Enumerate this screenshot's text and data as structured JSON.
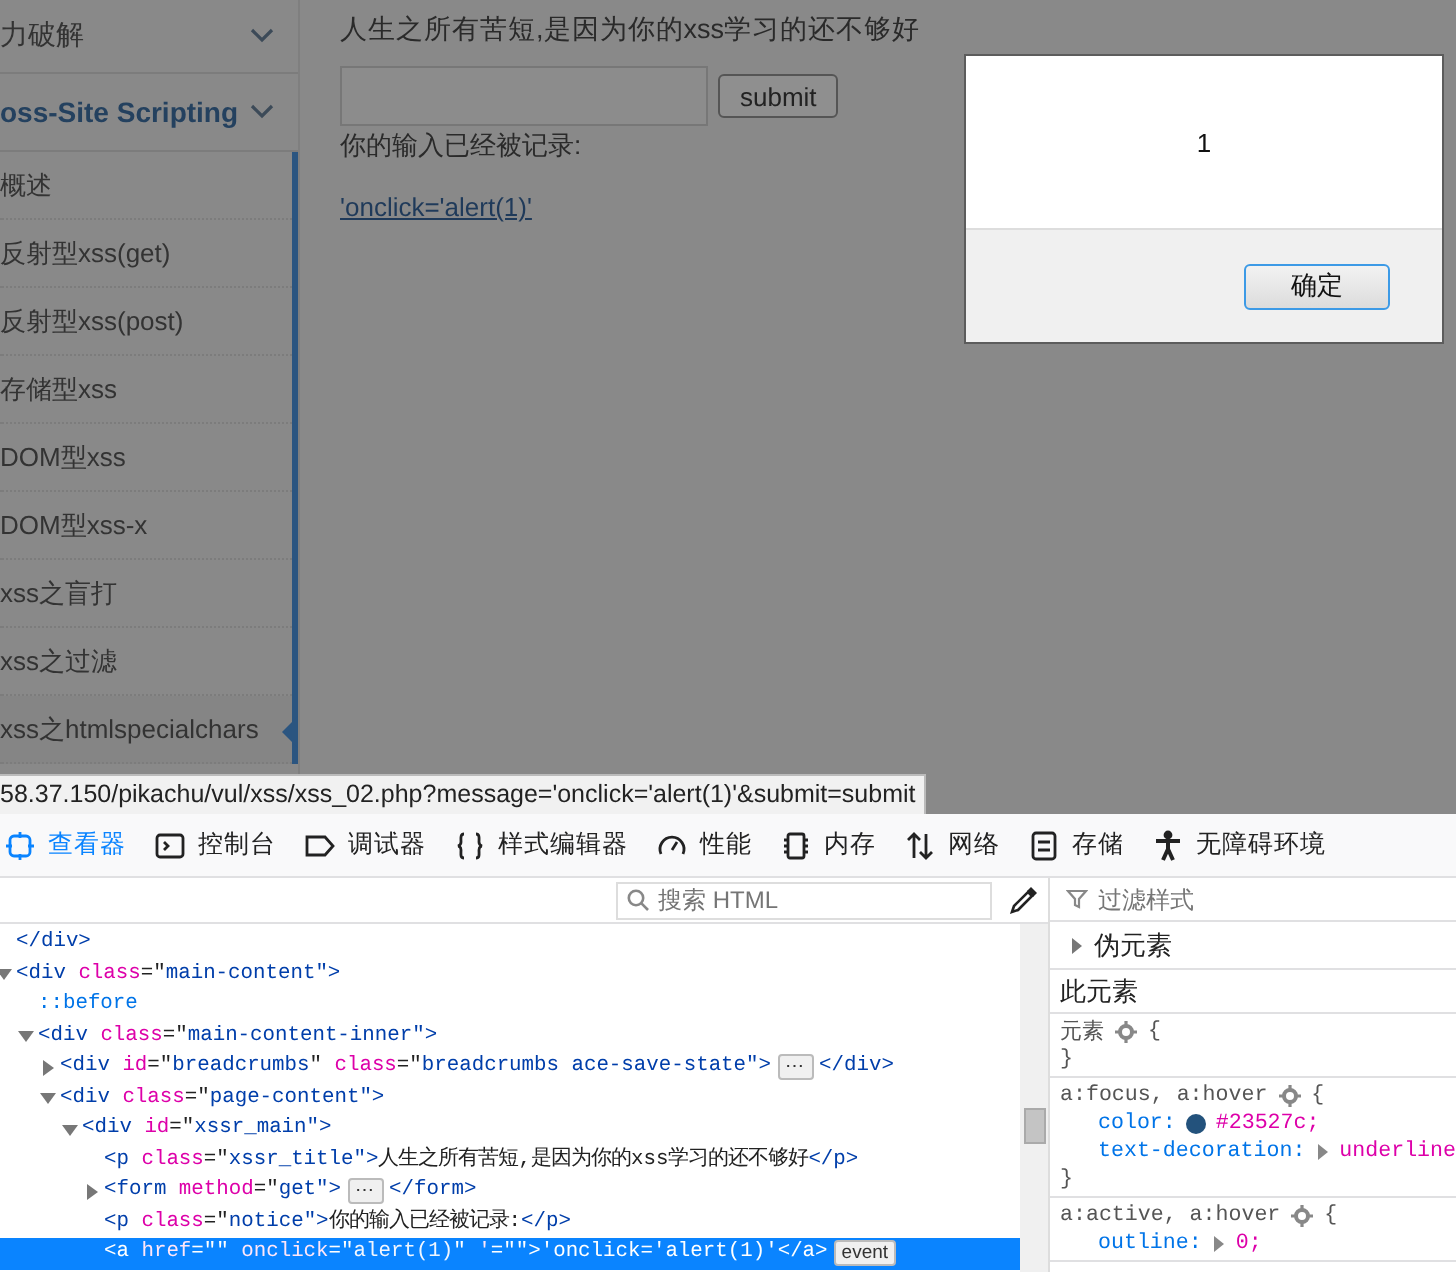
{
  "sidebar": {
    "sections": [
      {
        "label": "力破解",
        "selected": false
      },
      {
        "label": "oss-Site Scripting",
        "selected": true
      }
    ],
    "items": [
      {
        "label": "概述",
        "selected": false
      },
      {
        "label": "反射型xss(get)",
        "selected": false
      },
      {
        "label": "反射型xss(post)",
        "selected": false
      },
      {
        "label": "存储型xss",
        "selected": false
      },
      {
        "label": "DOM型xss",
        "selected": false
      },
      {
        "label": "DOM型xss-x",
        "selected": false
      },
      {
        "label": "xss之盲打",
        "selected": false
      },
      {
        "label": "xss之过滤",
        "selected": false
      },
      {
        "label": "xss之htmlspecialchars",
        "selected": true
      }
    ]
  },
  "main": {
    "title": "人生之所有苦短,是因为你的xss学习的还不够好",
    "submit": "submit",
    "notice": "你的输入已经被记录:",
    "link": "'onclick='alert(1)'"
  },
  "alert": {
    "message": "1",
    "button": "确定"
  },
  "status_url": "58.37.150/pikachu/vul/xss/xss_02.php?message='onclick='alert(1)'&submit=submit",
  "devtools": {
    "tabs": [
      {
        "label": "查看器",
        "selected": true
      },
      {
        "label": "控制台",
        "selected": false
      },
      {
        "label": "调试器",
        "selected": false
      },
      {
        "label": "样式编辑器",
        "selected": false
      },
      {
        "label": "性能",
        "selected": false
      },
      {
        "label": "内存",
        "selected": false
      },
      {
        "label": "网络",
        "selected": false
      },
      {
        "label": "存储",
        "selected": false
      },
      {
        "label": "无障碍环境",
        "selected": false
      }
    ],
    "search_placeholder": "搜索 HTML",
    "html_tree": [
      {
        "tokens": [
          {
            "text": "</div>",
            "kind": "tag"
          }
        ]
      },
      {
        "expanded": true,
        "tokens": [
          {
            "text": "<div ",
            "kind": "tag"
          },
          {
            "text": "class",
            "kind": "attr"
          },
          {
            "text": "=\"",
            "kind": "text"
          },
          {
            "text": "main-content",
            "kind": "value"
          },
          {
            "text": "\">",
            "kind": "tag"
          }
        ],
        "children": [
          {
            "tokens": [
              {
                "text": "::before",
                "kind": "pseudo"
              }
            ]
          },
          {
            "expanded": true,
            "tokens": [
              {
                "text": "<div ",
                "kind": "tag"
              },
              {
                "text": "class",
                "kind": "attr"
              },
              {
                "text": "=\"",
                "kind": "text"
              },
              {
                "text": "main-content-inner",
                "kind": "value"
              },
              {
                "text": "\">",
                "kind": "tag"
              }
            ],
            "children": [
              {
                "expanded": false,
                "tokens": [
                  {
                    "text": "<div ",
                    "kind": "tag"
                  },
                  {
                    "text": "id",
                    "kind": "attr"
                  },
                  {
                    "text": "=\"",
                    "kind": "text"
                  },
                  {
                    "text": "breadcrumbs",
                    "kind": "value"
                  },
                  {
                    "text": "\" ",
                    "kind": "text"
                  },
                  {
                    "text": "class",
                    "kind": "attr"
                  },
                  {
                    "text": "=\"",
                    "kind": "text"
                  },
                  {
                    "text": "breadcrumbs ace-save-state",
                    "kind": "value"
                  },
                  {
                    "text": "\">",
                    "kind": "tag"
                  }
                ],
                "badge": "⋯",
                "tail": [
                  {
                    "text": "</div>",
                    "kind": "tag"
                  }
                ]
              },
              {
                "expanded": true,
                "tokens": [
                  {
                    "text": "<div ",
                    "kind": "tag"
                  },
                  {
                    "text": "class",
                    "kind": "attr"
                  },
                  {
                    "text": "=\"",
                    "kind": "text"
                  },
                  {
                    "text": "page-content",
                    "kind": "value"
                  },
                  {
                    "text": "\">",
                    "kind": "tag"
                  }
                ],
                "children": [
                  {
                    "expanded": true,
                    "tokens": [
                      {
                        "text": "<div ",
                        "kind": "tag"
                      },
                      {
                        "text": "id",
                        "kind": "attr"
                      },
                      {
                        "text": "=\"",
                        "kind": "text"
                      },
                      {
                        "text": "xssr_main",
                        "kind": "value"
                      },
                      {
                        "text": "\">",
                        "kind": "tag"
                      }
                    ],
                    "children": [
                      {
                        "tokens": [
                          {
                            "text": "<p ",
                            "kind": "tag"
                          },
                          {
                            "text": "class",
                            "kind": "attr"
                          },
                          {
                            "text": "=\"",
                            "kind": "text"
                          },
                          {
                            "text": "xssr_title",
                            "kind": "value"
                          },
                          {
                            "text": "\">",
                            "kind": "tag"
                          },
                          {
                            "text": "人生之所有苦短,是因为你的xss学习的还不够好",
                            "kind": "text"
                          },
                          {
                            "text": "</p>",
                            "kind": "tag"
                          }
                        ]
                      },
                      {
                        "expanded": false,
                        "tokens": [
                          {
                            "text": "<form ",
                            "kind": "tag"
                          },
                          {
                            "text": "method",
                            "kind": "attr"
                          },
                          {
                            "text": "=\"",
                            "kind": "text"
                          },
                          {
                            "text": "get",
                            "kind": "value"
                          },
                          {
                            "text": "\">",
                            "kind": "tag"
                          }
                        ],
                        "badge": "⋯",
                        "tail": [
                          {
                            "text": "</form>",
                            "kind": "tag"
                          }
                        ]
                      },
                      {
                        "tokens": [
                          {
                            "text": "<p ",
                            "kind": "tag"
                          },
                          {
                            "text": "class",
                            "kind": "attr"
                          },
                          {
                            "text": "=\"",
                            "kind": "text"
                          },
                          {
                            "text": "notice",
                            "kind": "value"
                          },
                          {
                            "text": "\">",
                            "kind": "tag"
                          },
                          {
                            "text": "你的输入已经被记录:",
                            "kind": "text"
                          },
                          {
                            "text": "</p>",
                            "kind": "tag"
                          }
                        ]
                      },
                      {
                        "selected": true,
                        "tokens": [
                          {
                            "text": "<a ",
                            "kind": "tag"
                          },
                          {
                            "text": "href",
                            "kind": "attr"
                          },
                          {
                            "text": "=\"\" ",
                            "kind": "text"
                          },
                          {
                            "text": "onclick",
                            "kind": "attr"
                          },
                          {
                            "text": "=\"",
                            "kind": "text"
                          },
                          {
                            "text": "alert(1)",
                            "kind": "value"
                          },
                          {
                            "text": "\" ",
                            "kind": "text"
                          },
                          {
                            "text": "'",
                            "kind": "attr"
                          },
                          {
                            "text": "=\"\">",
                            "kind": "text"
                          },
                          {
                            "text": "'onclick='alert(1)'",
                            "kind": "text"
                          },
                          {
                            "text": "</a>",
                            "kind": "tag"
                          }
                        ],
                        "badge": "event"
                      }
                    ]
                  }
                ]
              }
            ]
          }
        ]
      }
    ],
    "filter_placeholder": "过滤样式",
    "pseudo": {
      "label": "伪元素",
      "expanded": false
    },
    "section_title": "此元素",
    "rules": [
      {
        "selector": "元素",
        "open": "{",
        "close": "}"
      },
      {
        "selector": "a:focus, a:hover",
        "open": "{",
        "declarations": [
          {
            "name": "color:",
            "value": "#23527c;",
            "color": "#23527c"
          },
          {
            "name": "text-decoration:",
            "value": "underline",
            "expanded": false
          }
        ],
        "close": "}"
      },
      {
        "selector": "a:active, a:hover",
        "open": "{",
        "declarations": [
          {
            "name": "outline:",
            "value": "0;",
            "expanded": false
          }
        ]
      }
    ]
  }
}
